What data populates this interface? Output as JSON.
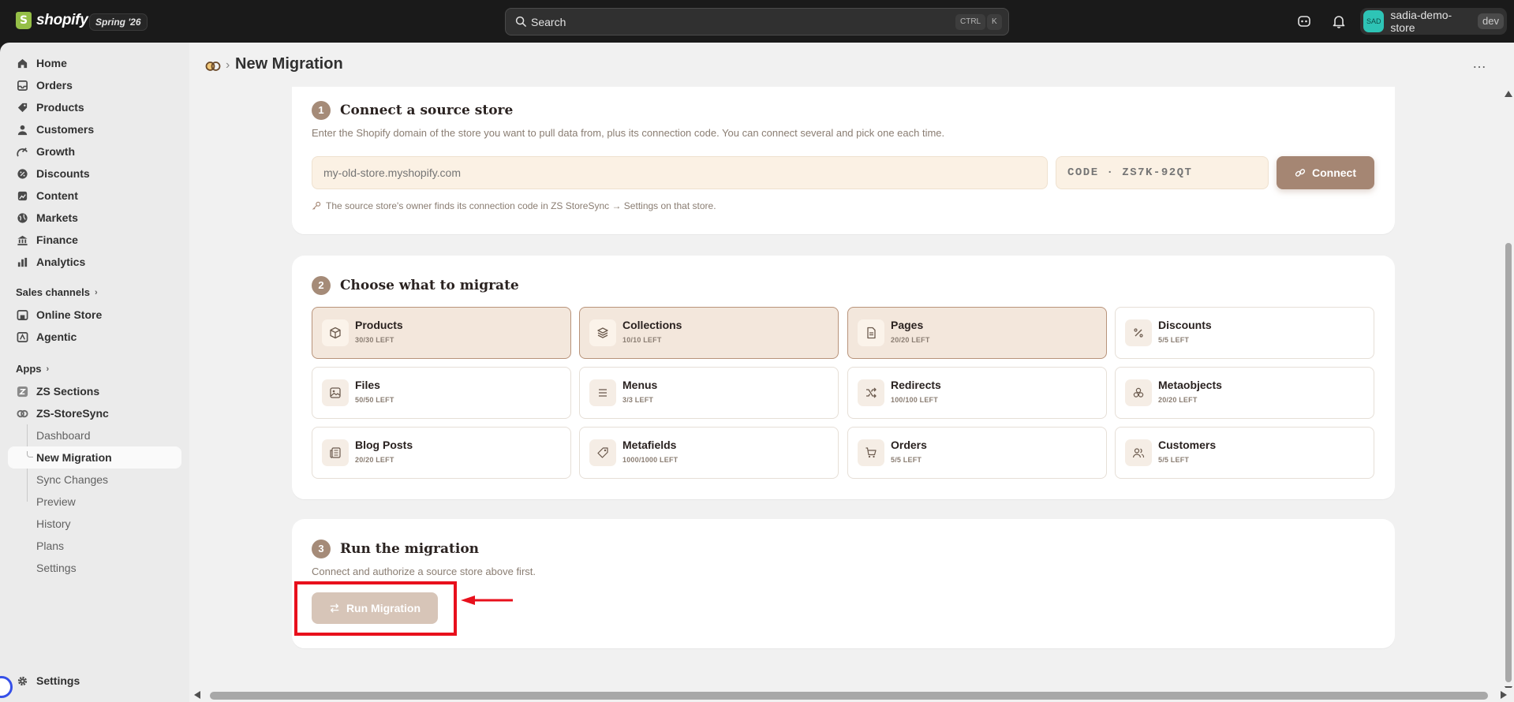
{
  "topbar": {
    "brand": "shopify",
    "edition": "Spring '26",
    "search_placeholder": "Search",
    "shortcut_ctrl": "CTRL",
    "shortcut_key": "K",
    "store_name": "sadia-demo-store",
    "store_avatar": "SAD",
    "env_badge": "dev"
  },
  "sidebar": {
    "items": [
      {
        "label": "Home",
        "icon": "home-icon"
      },
      {
        "label": "Orders",
        "icon": "orders-icon"
      },
      {
        "label": "Products",
        "icon": "tag-icon"
      },
      {
        "label": "Customers",
        "icon": "person-icon"
      },
      {
        "label": "Growth",
        "icon": "growth-icon"
      },
      {
        "label": "Discounts",
        "icon": "discount-icon"
      },
      {
        "label": "Content",
        "icon": "content-icon"
      },
      {
        "label": "Markets",
        "icon": "globe-icon"
      },
      {
        "label": "Finance",
        "icon": "bank-icon"
      },
      {
        "label": "Analytics",
        "icon": "chart-icon"
      }
    ],
    "sales_channels_label": "Sales channels",
    "channels": [
      {
        "label": "Online Store",
        "icon": "store-icon"
      },
      {
        "label": "Agentic",
        "icon": "agentic-icon"
      }
    ],
    "apps_label": "Apps",
    "apps": [
      {
        "label": "ZS Sections",
        "icon": "zs-sections-icon"
      },
      {
        "label": "ZS-StoreSync",
        "icon": "storesync-icon"
      }
    ],
    "sub_items": [
      {
        "label": "Dashboard"
      },
      {
        "label": "New Migration"
      },
      {
        "label": "Sync Changes"
      },
      {
        "label": "Preview"
      },
      {
        "label": "History"
      },
      {
        "label": "Plans"
      },
      {
        "label": "Settings"
      }
    ],
    "footer_settings": "Settings"
  },
  "page": {
    "breadcrumb_title": "New Migration",
    "more_actions": "…"
  },
  "step1": {
    "number": "1",
    "heading": "Connect a source store",
    "description": "Enter the Shopify domain of the store you want to pull data from, plus its connection code. You can connect several and pick one each time.",
    "domain_placeholder": "my-old-store.myshopify.com",
    "code_placeholder": "CODE · ZS7K-92QT",
    "connect_label": "Connect",
    "hint": "The source store's owner finds its connection code in ZS StoreSync → Settings on that store."
  },
  "step2": {
    "number": "2",
    "heading": "Choose what to migrate",
    "tiles": [
      {
        "name": "Products",
        "count": "30/30 LEFT",
        "selected": true,
        "icon": "box-icon"
      },
      {
        "name": "Collections",
        "count": "10/10 LEFT",
        "selected": true,
        "icon": "layers-icon"
      },
      {
        "name": "Pages",
        "count": "20/20 LEFT",
        "selected": true,
        "icon": "page-icon"
      },
      {
        "name": "Discounts",
        "count": "5/5 LEFT",
        "selected": false,
        "icon": "percent-icon"
      },
      {
        "name": "Files",
        "count": "50/50 LEFT",
        "selected": false,
        "icon": "image-icon"
      },
      {
        "name": "Menus",
        "count": "3/3 LEFT",
        "selected": false,
        "icon": "menu-icon"
      },
      {
        "name": "Redirects",
        "count": "100/100 LEFT",
        "selected": false,
        "icon": "shuffle-icon"
      },
      {
        "name": "Metaobjects",
        "count": "20/20 LEFT",
        "selected": false,
        "icon": "shapes-icon"
      },
      {
        "name": "Blog Posts",
        "count": "20/20 LEFT",
        "selected": false,
        "icon": "newspaper-icon"
      },
      {
        "name": "Metafields",
        "count": "1000/1000 LEFT",
        "selected": false,
        "icon": "label-icon"
      },
      {
        "name": "Orders",
        "count": "5/5 LEFT",
        "selected": false,
        "icon": "cart-icon"
      },
      {
        "name": "Customers",
        "count": "5/5 LEFT",
        "selected": false,
        "icon": "users-icon"
      }
    ]
  },
  "step3": {
    "number": "3",
    "heading": "Run the migration",
    "description": "Connect and authorize a source store above first.",
    "run_label": "Run Migration"
  },
  "colors": {
    "accent": "#a58673",
    "selected_tile_bg": "#f3e7dc",
    "input_bg": "#fbf1e4",
    "annotation_red": "#e8101c"
  }
}
